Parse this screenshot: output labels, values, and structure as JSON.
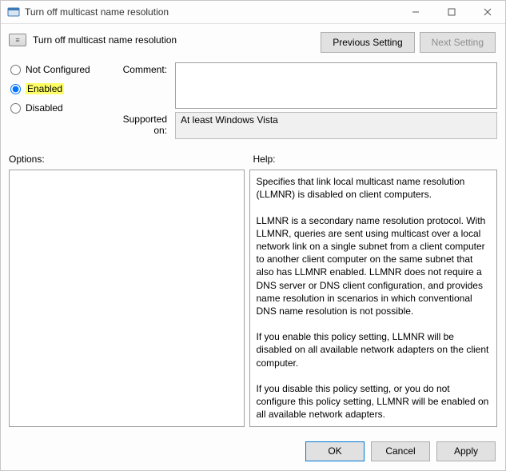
{
  "window": {
    "title": "Turn off multicast name resolution"
  },
  "header": {
    "policy_title": "Turn off multicast name resolution",
    "prev_setting": "Previous Setting",
    "next_setting": "Next Setting"
  },
  "config": {
    "radios": {
      "not_configured": "Not Configured",
      "enabled": "Enabled",
      "disabled": "Disabled",
      "selected": "enabled"
    },
    "comment_label": "Comment:",
    "comment_value": "",
    "supported_label": "Supported on:",
    "supported_value": "At least Windows Vista"
  },
  "sections": {
    "options_label": "Options:",
    "help_label": "Help:",
    "help_text": "Specifies that link local multicast name resolution (LLMNR) is disabled on client computers.\n\nLLMNR is a secondary name resolution protocol. With LLMNR, queries are sent using multicast over a local network link on a single subnet from a client computer to another client computer on the same subnet that also has LLMNR enabled. LLMNR does not require a DNS server or DNS client configuration, and provides name resolution in scenarios in which conventional DNS name resolution is not possible.\n\nIf you enable this policy setting, LLMNR will be disabled on all available network adapters on the client computer.\n\nIf you disable this policy setting, or you do not configure this policy setting, LLMNR will be enabled on all available network adapters."
  },
  "buttons": {
    "ok": "OK",
    "cancel": "Cancel",
    "apply": "Apply"
  }
}
